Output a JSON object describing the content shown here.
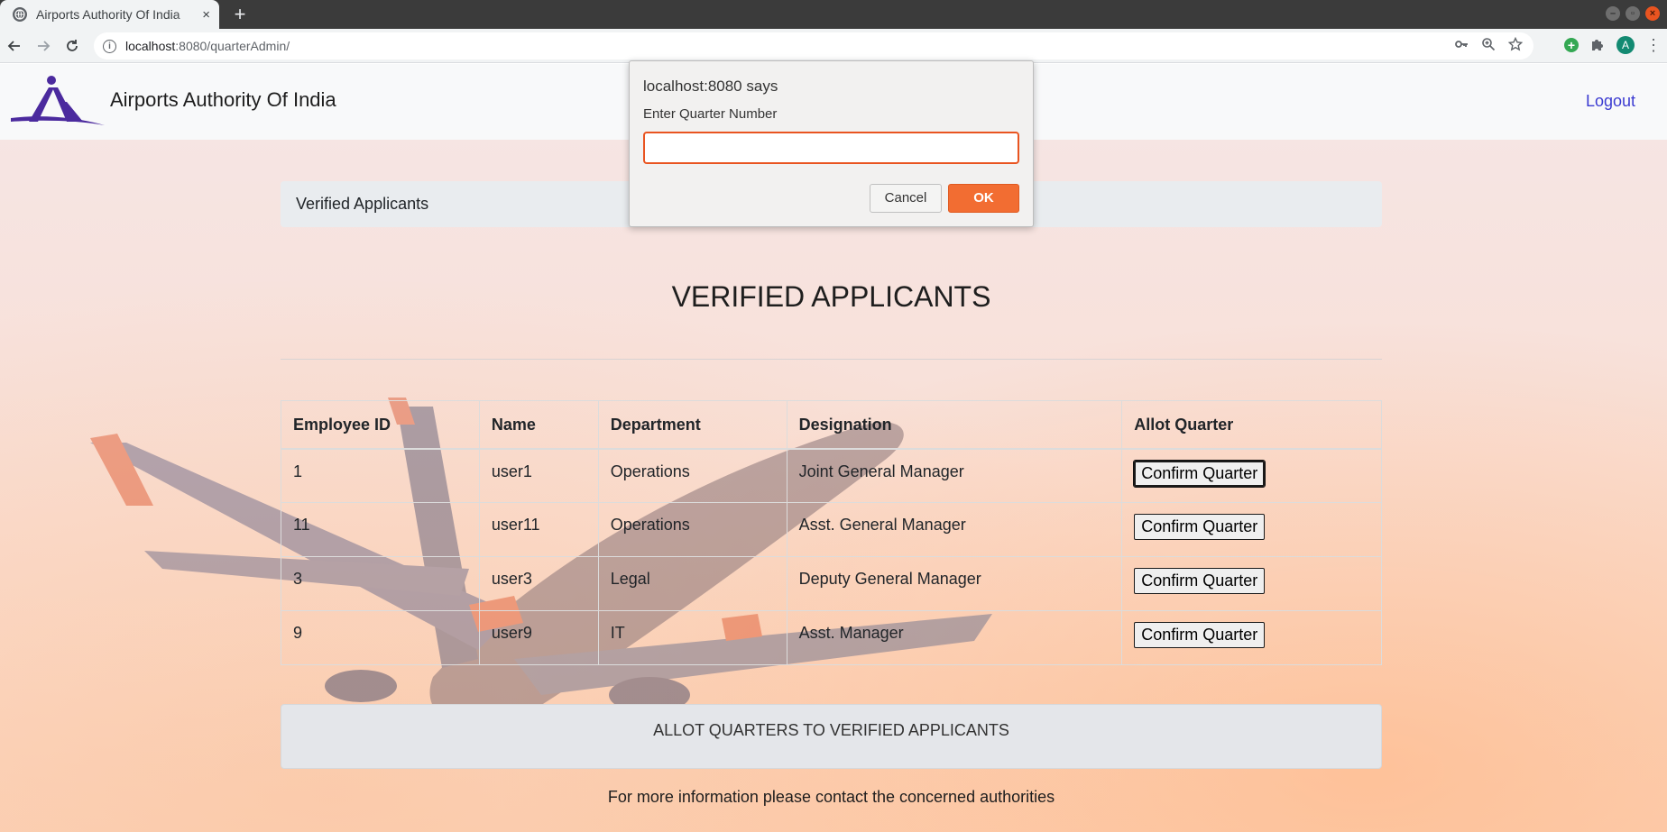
{
  "browser": {
    "tab_title": "Airports Authority Of India",
    "url_host": "localhost",
    "url_path": ":8080/quarterAdmin/",
    "profile_initial": "A",
    "new_tab": "+",
    "close_tab": "×"
  },
  "navbar": {
    "brand": "Airports Authority Of India",
    "logout": "Logout"
  },
  "breadcrumb": "Verified Applicants",
  "heading": "VERIFIED APPLICANTS",
  "table": {
    "headers": [
      "Employee ID",
      "Name",
      "Department",
      "Designation",
      "Allot Quarter"
    ],
    "rows": [
      {
        "id": "1",
        "name": "user1",
        "department": "Operations",
        "designation": "Joint General Manager",
        "action": "Confirm Quarter"
      },
      {
        "id": "11",
        "name": "user11",
        "department": "Operations",
        "designation": "Asst. General Manager",
        "action": "Confirm Quarter"
      },
      {
        "id": "3",
        "name": "user3",
        "department": "Legal",
        "designation": "Deputy General Manager",
        "action": "Confirm Quarter"
      },
      {
        "id": "9",
        "name": "user9",
        "department": "IT",
        "designation": "Asst. Manager",
        "action": "Confirm Quarter"
      }
    ]
  },
  "allot_card": "ALLOT QUARTERS TO VERIFIED APPLICANTS",
  "footer": "For more information please contact the concerned authorities",
  "dialog": {
    "title": "localhost:8080 says",
    "message": "Enter Quarter Number",
    "input_value": "",
    "cancel": "Cancel",
    "ok": "OK"
  },
  "colors": {
    "accent": "#f26d32",
    "link": "#3b3bd1",
    "logo": "#4b2a9e"
  },
  "icons": [
    "globe-icon",
    "back-icon",
    "forward-icon",
    "reload-icon",
    "info-icon",
    "key-icon",
    "zoom-icon",
    "star-icon",
    "extension-icon",
    "puzzle-icon",
    "menu-icon"
  ]
}
